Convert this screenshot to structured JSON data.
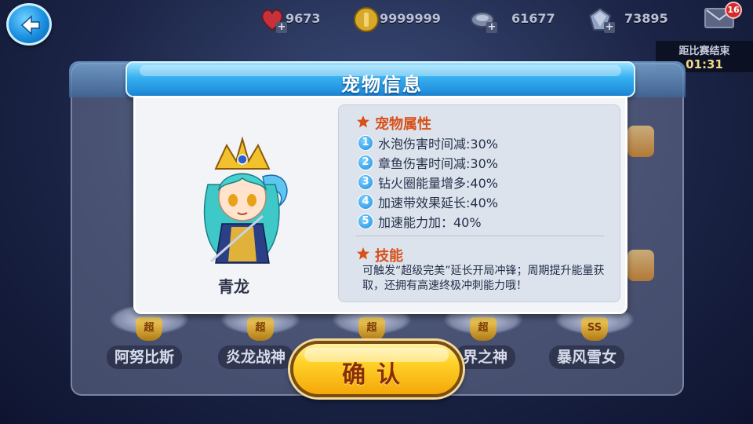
{
  "top_bar": {
    "hearts": "9673",
    "coins": "9999999",
    "gems_green": "61677",
    "gems_blue": "73895",
    "mail_badge": "16"
  },
  "timer": {
    "label": "距比赛结束",
    "value": "01:31"
  },
  "background_pets": [
    {
      "name": "阿努比斯",
      "badge": "超"
    },
    {
      "name": "炎龙战神",
      "badge": "超"
    },
    {
      "name": "",
      "badge": "超"
    },
    {
      "name": "界之神",
      "badge": "超"
    },
    {
      "name": "暴风雪女",
      "badge": "SS"
    }
  ],
  "dialog": {
    "title": "宠物信息",
    "pet_name": "青龙",
    "attributes_title": "宠物属性",
    "attributes": [
      {
        "num": "1",
        "text": "水泡伤害时间减:30%"
      },
      {
        "num": "2",
        "text": "章鱼伤害时间减:30%"
      },
      {
        "num": "3",
        "text": "钻火圈能量增多:40%"
      },
      {
        "num": "4",
        "text": "加速带效果延长:40%"
      },
      {
        "num": "5",
        "text": "加速能力加：40%"
      }
    ],
    "skill_title": "技能",
    "skill_desc": "可触发“超级完美”延长开局冲锋；周期提升能量获取，还拥有高速终极冲刺能力哦！"
  },
  "confirm_button": {
    "label": "确认"
  },
  "colors": {
    "header_blue": "#1c86d6",
    "section_title": "#d8501a",
    "button_gold": "#ffd42a"
  },
  "icons": [
    "back-arrow-icon",
    "heart-icon",
    "coin-icon",
    "green-gem-icon",
    "blue-gem-icon",
    "mail-icon",
    "star-icon"
  ]
}
